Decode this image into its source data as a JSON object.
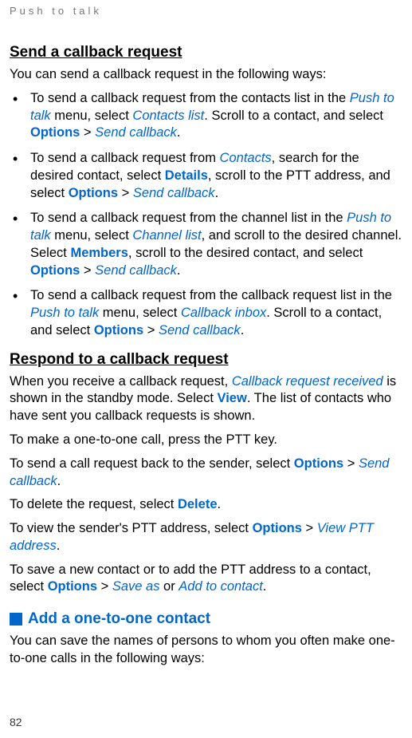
{
  "header": "Push to talk",
  "s1": {
    "heading": "Send a callback request",
    "intro": "You can send a callback request in the following ways:",
    "b1": {
      "t1": "To send a callback request from the contacts list in the ",
      "l1": "Push to talk",
      "t2": " menu, select ",
      "l2": "Contacts list",
      "t3": ". Scroll to a contact, and select ",
      "l3": "Options",
      "t4": " > ",
      "l4": "Send callback",
      "t5": "."
    },
    "b2": {
      "t1": "To send a callback request from ",
      "l1": "Contacts",
      "t2": ", search for the desired contact, select ",
      "l2": "Details",
      "t3": ", scroll to the PTT address, and select ",
      "l3": "Options",
      "t4": " > ",
      "l4": "Send callback",
      "t5": "."
    },
    "b3": {
      "t1": "To send a callback request from the channel list in the ",
      "l1": "Push to talk",
      "t2": " menu, select ",
      "l2": "Channel list",
      "t3": ", and scroll to the desired channel. Select ",
      "l3": "Members",
      "t4": ", scroll to the desired contact, and select ",
      "l4": "Options",
      "t5": " > ",
      "l5": "Send callback",
      "t6": "."
    },
    "b4": {
      "t1": "To send a callback request from the callback request list in the ",
      "l1": "Push to talk",
      "t2": " menu, select ",
      "l2": "Callback inbox",
      "t3": ". Scroll to a contact, and select ",
      "l3": "Options",
      "t4": " > ",
      "l4": "Send callback",
      "t5": "."
    }
  },
  "s2": {
    "heading": "Respond to a callback request",
    "p1": {
      "t1": "When you receive a callback request, ",
      "l1": "Callback request received",
      "t2": " is shown in the standby mode. Select ",
      "l2": "View",
      "t3": ". The list of contacts who have sent you callback requests is shown."
    },
    "p2": "To make a one-to-one call, press the PTT key.",
    "p3": {
      "t1": "To send a call request back to the sender, select ",
      "l1": "Options",
      "t2": " > ",
      "l2": "Send callback",
      "t3": "."
    },
    "p4": {
      "t1": "To delete the request, select ",
      "l1": "Delete",
      "t2": "."
    },
    "p5": {
      "t1": "To view the sender's PTT address, select ",
      "l1": "Options",
      "t2": " > ",
      "l2": "View PTT address",
      "t3": "."
    },
    "p6": {
      "t1": "To save a new contact or to add the PTT address to a contact, select ",
      "l1": "Options",
      "t2": " > ",
      "l2": "Save as",
      "t3": " or ",
      "l3": "Add to contact",
      "t4": "."
    }
  },
  "s3": {
    "heading": "Add a one-to-one contact",
    "intro": "You can save the names of persons to whom you often make one-to-one calls in the following ways:"
  },
  "pageNumber": "82"
}
